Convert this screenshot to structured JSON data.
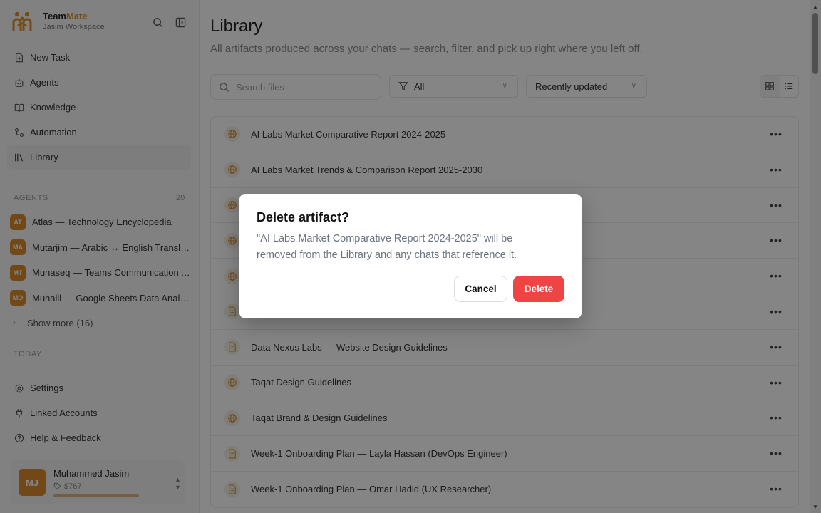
{
  "brand": {
    "name_part1": "Team",
    "name_part2": "Mate",
    "workspace": "Jasim Workspace"
  },
  "nav": [
    {
      "label": "New Task",
      "icon": "file-plus-icon"
    },
    {
      "label": "Agents",
      "icon": "robot-icon"
    },
    {
      "label": "Knowledge",
      "icon": "book-icon"
    },
    {
      "label": "Automation",
      "icon": "workflow-icon"
    },
    {
      "label": "Library",
      "icon": "library-icon",
      "active": true
    }
  ],
  "agents_section": {
    "label": "AGENTS",
    "count": "20",
    "items": [
      {
        "initials": "AT",
        "label": "Atlas — Technology Encyclopedia"
      },
      {
        "initials": "MA",
        "label": "Mutarjim — Arabic ↔ English Translator"
      },
      {
        "initials": "MT",
        "label": "Munaseq — Teams Communication Assistant"
      },
      {
        "initials": "MO",
        "label": "Muhalil — Google Sheets Data Analyst"
      }
    ],
    "show_more": "Show more (16)"
  },
  "today_label": "TODAY",
  "bottom_nav": [
    {
      "label": "Settings",
      "icon": "gear-icon"
    },
    {
      "label": "Linked Accounts",
      "icon": "plug-icon"
    },
    {
      "label": "Help & Feedback",
      "icon": "help-circle-icon"
    }
  ],
  "user": {
    "initials": "MJ",
    "name": "Muhammed Jasim",
    "credit": "$767"
  },
  "main": {
    "title": "Library",
    "subtitle": "All artifacts produced across your chats — search, filter, and pick up right where you left off.",
    "search_placeholder": "Search files",
    "filter_value": "All",
    "sort_value": "Recently updated"
  },
  "files": [
    {
      "title": "AI Labs Market Comparative Report 2024-2025",
      "icon": "globe-icon"
    },
    {
      "title": "AI Labs Market Trends & Comparison Report 2025-2030",
      "icon": "globe-icon"
    },
    {
      "title": "",
      "icon": "globe-icon"
    },
    {
      "title": "",
      "icon": "globe-icon"
    },
    {
      "title": "",
      "icon": "globe-icon"
    },
    {
      "title": "",
      "icon": "document-icon"
    },
    {
      "title": "Data Nexus Labs — Website Design Guidelines",
      "icon": "document-icon"
    },
    {
      "title": "Taqat Design Guidelines",
      "icon": "globe-icon"
    },
    {
      "title": "Taqat Brand & Design Guidelines",
      "icon": "globe-icon"
    },
    {
      "title": "Week-1 Onboarding Plan — Layla Hassan (DevOps Engineer)",
      "icon": "document-icon"
    },
    {
      "title": "Week-1 Onboarding Plan — Omar Hadid (UX Researcher)",
      "icon": "document-icon"
    }
  ],
  "dialog": {
    "title": "Delete artifact?",
    "body": "\"AI Labs Market Comparative Report 2024-2025\" will be removed from the Library and any chats that reference it.",
    "cancel_label": "Cancel",
    "delete_label": "Delete"
  },
  "colors": {
    "accent": "#d98a2b",
    "danger": "#ef4444"
  }
}
